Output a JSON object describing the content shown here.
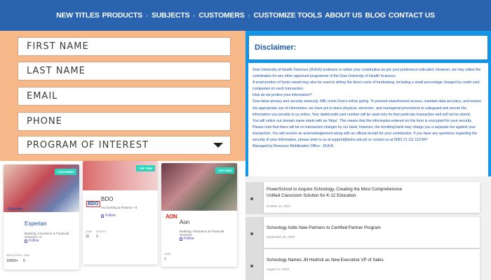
{
  "nav": {
    "items": [
      "NEW TITLES",
      "PRODUCTS",
      "SUBJECTS",
      "CUSTOMERS",
      "CUSTOMIZE TOOLS",
      "ABOUT US",
      "BLOG",
      "CONTACT US"
    ]
  },
  "form": {
    "first_name": "FIRST NAME",
    "last_name": "LAST NAME",
    "email": "EMAIL",
    "phone": "PHONE",
    "program": "PROGRAM OF INTEREST"
  },
  "disclaimer": {
    "heading": "Disclaimer:",
    "lines": [
      "Dow University of Health Sciences (DUHS) endeavor to utilize your contribution as per your preference indicated. However, we may utilise the",
      "contribution for any other approved programme of the Dow University of Health Sciences.",
      "A small portion of funds raised may also be used to defray the direct costs of fundraising, including a small percentage charged by credit card",
      "companies on each transaction.",
      "How do we protect your information?",
      "Dow takes privacy and security seriously. HBL hosts Dow's online giving. To prevent unauthorized access, maintain data accuracy, and ensure",
      "the appropriate use of information, we have put in place physical, electronic, and managerial procedures to safeguard and secure the",
      "information you provide to us online. Your debit/credit card number will be used only for that particular transaction and will not be stored.",
      "You will notice our domain name starts with an 'https'. This means that the information entered on this form is encrypted for your security.",
      "Please note that there will be no transaction charges by our bank; however, the remitting bank may charge you a separate fee against your",
      "transaction. You will receive an acknowledgement along with an official receipt for your contribution. If you have any questions regarding the",
      "security of your information, please write to us at support@duhs.edu.pk or contact us at 0092 21 111 113 847",
      "Managed by Resource Mobilization Office - DUHS."
    ]
  },
  "cards": [
    {
      "badge": "CUSTOMER",
      "logo": "Experian",
      "name": "Experian",
      "desc": "Banking, Insurance & Financial Services +4",
      "follow": "Follow",
      "stat1_label": "EMPLOYEES",
      "stat1_value": "10000+",
      "stat2_label": "JOBS",
      "stat2_value": "5"
    },
    {
      "badge": "TOP FIRM",
      "logo": "BDO",
      "name": "BDO",
      "desc": "Accounting & Finance +3",
      "follow": "Follow",
      "stat1_label": "JOBS",
      "stat1_value": "11",
      "stat2_label": "EVENTS",
      "stat2_value": "1"
    },
    {
      "badge": "TOP FIRM",
      "logo": "AON",
      "name": "Aon",
      "desc": "Banking, Insurance & Financial Services",
      "follow": "Follow",
      "stat1_label": "JOBS",
      "stat1_value": "7"
    }
  ],
  "news": [
    {
      "title_line1": "PowerSchool to Acquire Schoology, Creating the Most Comprehensive",
      "title_line2": "Unified Classroom Solution for K-12 Education",
      "date": "October 24, 2019"
    },
    {
      "title_line1": "Schoology Adds New Partners to Certified Partner Program",
      "title_line2": "",
      "date": "September 05, 2019"
    },
    {
      "title_line1": "Schoology Names Jill Hedrick as New Executive VP of Sales",
      "title_line2": "",
      "date": "August 12, 2019"
    }
  ],
  "colors": {
    "nav_bg": "#2a63b0",
    "form_bg": "#f8b98a",
    "disclaimer_bg": "#1396ea",
    "badge": "#2ed4bd"
  }
}
